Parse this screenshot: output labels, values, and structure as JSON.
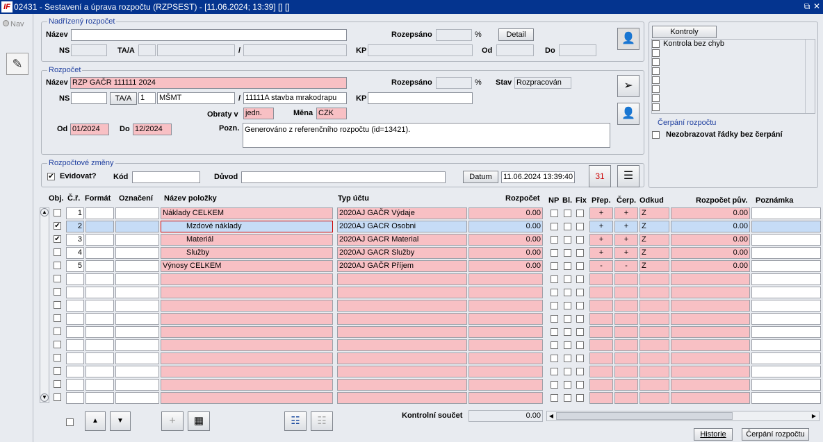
{
  "window": {
    "logo": "IF",
    "title": "02431 - Sestavení a úprava rozpočtu (RZPSEST) - [11.06.2024; 13:39]  [] []",
    "restore_glyph": "⧉",
    "close_glyph": "✕"
  },
  "left": {
    "nav_label": "Nav"
  },
  "parent_budget": {
    "title": "Nadřízený rozpočet",
    "name_label": "Název",
    "name_value": "",
    "rozepsano_label": "Rozepsáno",
    "rozepsano_value": "",
    "pct": "%",
    "detail_label": "Detail",
    "ns_label": "NS",
    "ns_value": "",
    "taa_label": "TA/A",
    "taa_value": "",
    "taa_name": "",
    "slash": "/",
    "slash_value": "",
    "kp_label": "KP",
    "kp_value": "",
    "od_label": "Od",
    "od_value": "",
    "do_label": "Do",
    "do_value": ""
  },
  "budget": {
    "title": "Rozpočet",
    "name_label": "Název",
    "name_value": "RZP GAČR 111111 2024",
    "rozepsano_label": "Rozepsáno",
    "rozepsano_value": "",
    "pct": "%",
    "stav_label": "Stav",
    "stav_value": "Rozpracován",
    "ns_label": "NS",
    "ns_value": "",
    "taa_btn": "TA/A",
    "taa_value": "1",
    "taa_name": "MŠMT",
    "slash": "/",
    "slash_value": "11111A stavba mrakodrapu",
    "kp_label": "KP",
    "kp_value": "",
    "obraty_label": "Obraty v",
    "obraty_value": "jedn.",
    "mena_label": "Měna",
    "mena_value": "CZK",
    "od_label": "Od",
    "od_value": "01/2024",
    "do_label": "Do",
    "do_value": "12/2024",
    "pozn_label": "Pozn.",
    "pozn_value": "Generováno z referenčního rozpočtu (id=13421)."
  },
  "changes": {
    "title": "Rozpočtové změny",
    "evidovat_label": "Evidovat?",
    "evidovat_checked": "✔",
    "kod_label": "Kód",
    "kod_value": "",
    "duvod_label": "Důvod",
    "duvod_value": "",
    "datum_btn": "Datum",
    "datum_value": "11.06.2024 13:39:40"
  },
  "kontroly": {
    "btn": "Kontroly",
    "items": [
      "Kontrola bez chyb",
      "",
      "",
      "",
      "",
      "",
      "",
      ""
    ]
  },
  "cerpani": {
    "title": "Čerpání rozpočtu",
    "chk_label": "Nezobrazovat řádky bez čerpání"
  },
  "table": {
    "headers": {
      "obj": "Obj.",
      "cr": "Č.ř.",
      "format": "Formát",
      "oznaceni": "Označení",
      "nazev": "Název položky",
      "typ": "Typ účtu",
      "rozpocet": "Rozpočet",
      "np": "NP",
      "bl": "Bl.",
      "fix": "Fix",
      "prep": "Přep.",
      "cerp": "Čerp.",
      "odkud": "Odkud",
      "rozpuv": "Rozpočet pův.",
      "poznamka": "Poznámka"
    },
    "rows": [
      {
        "obj": "",
        "cr": "1",
        "nazev": "Náklady CELKEM",
        "typ": "2020AJ GAČR Výdaje",
        "rozpocet": "0.00",
        "prep": "+",
        "cerp": "+",
        "odkud": "Z",
        "rozpuv": "0.00"
      },
      {
        "obj": "✔",
        "cr": "2",
        "nazev": "Mzdové náklady",
        "typ": "2020AJ GACR Osobni",
        "rozpocet": "0.00",
        "prep": "+",
        "cerp": "+",
        "odkud": "Z",
        "rozpuv": "0.00"
      },
      {
        "obj": "✔",
        "cr": "3",
        "nazev": "Materiál",
        "typ": "2020AJ GACR Material",
        "rozpocet": "0.00",
        "prep": "+",
        "cerp": "+",
        "odkud": "Z",
        "rozpuv": "0.00"
      },
      {
        "obj": "",
        "cr": "4",
        "nazev": "Služby",
        "typ": "2020AJ GACR Služby",
        "rozpocet": "0.00",
        "prep": "+",
        "cerp": "+",
        "odkud": "Z",
        "rozpuv": "0.00"
      },
      {
        "obj": "",
        "cr": "5",
        "nazev": "Výnosy CELKEM",
        "typ": "2020AJ GAČR Příjem",
        "rozpocet": "0.00",
        "prep": "-",
        "cerp": "-",
        "odkud": "Z",
        "rozpuv": "0.00"
      }
    ],
    "empty_rows": 10
  },
  "footer": {
    "kontrolni_label": "Kontrolní součet",
    "kontrolni_value": "0.00",
    "historie": "Historie",
    "cerpani_btn": "Čerpání rozpočtu",
    "up": "▲",
    "down": "▼",
    "scroll_left": "◀",
    "scroll_right": "▶"
  },
  "colors": {
    "title_bg": "#04348f",
    "pink": "#f8c0c4",
    "selected_row": "#c6dcf6",
    "group_title": "#1f3f9f"
  }
}
